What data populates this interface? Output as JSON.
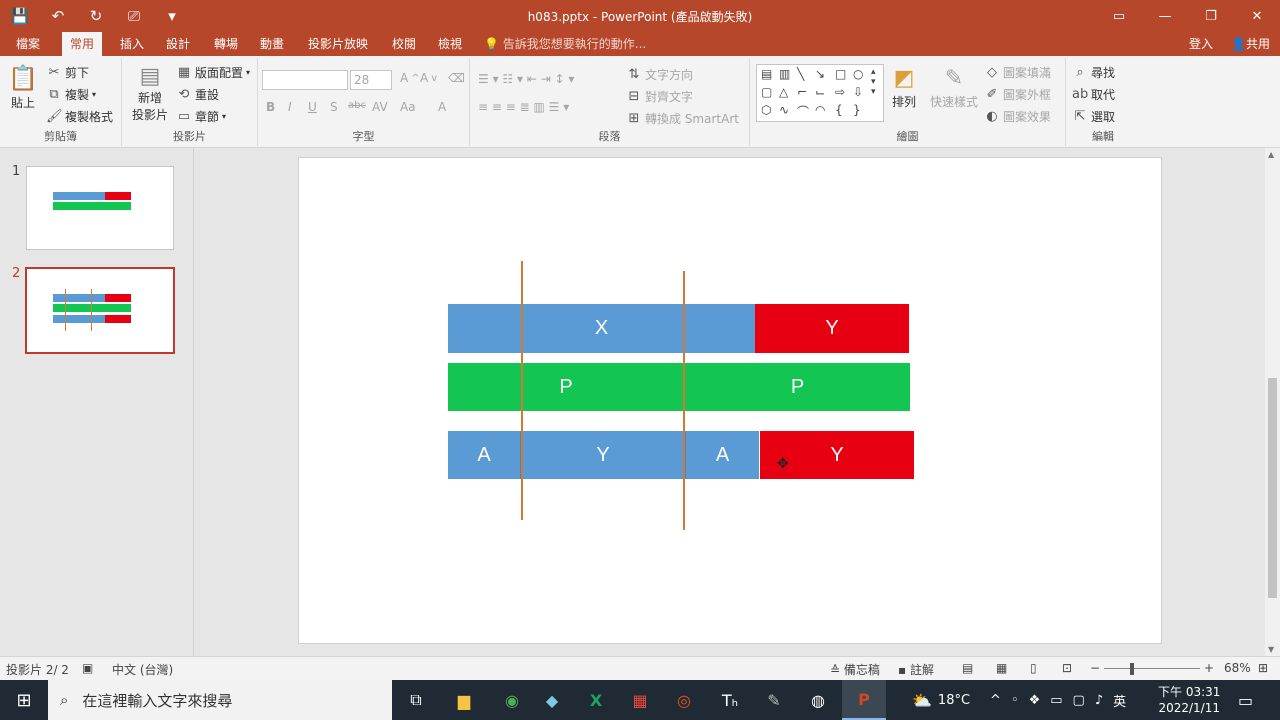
{
  "window": {
    "title": "h083.pptx - PowerPoint (產品啟動失敗)",
    "qat": [
      "💾",
      "↶",
      "↻",
      "⎚",
      "▾"
    ],
    "controls": [
      "▭",
      "—",
      "❐",
      "✕"
    ]
  },
  "tabs": [
    "檔案",
    "常用",
    "插入",
    "設計",
    "轉場",
    "動畫",
    "投影片放映",
    "校閱",
    "檢視"
  ],
  "tell_me": "告訴我您想要執行的動作...",
  "signin": "登入",
  "share": "共用",
  "ribbon": {
    "clipboard": {
      "paste": "貼上",
      "cut": "剪下",
      "copy": "複製",
      "format_painter": "複製格式",
      "label": "剪貼簿"
    },
    "slides": {
      "new_slide_line1": "新增",
      "new_slide_line2": "投影片",
      "layout": "版面配置",
      "reset": "重設",
      "section": "章節",
      "label": "投影片"
    },
    "font": {
      "size": "28",
      "label": "字型",
      "buttons": [
        "B",
        "I",
        "U",
        "S",
        "abc",
        "AV",
        "Aa",
        "A"
      ]
    },
    "paragraph": {
      "text_direction": "文字方向",
      "align_text": "對齊文字",
      "smartart": "轉換成 SmartArt",
      "label": "段落"
    },
    "drawing": {
      "arrange": "排列",
      "quick_styles": "快速樣式",
      "fill": "圖案填滿",
      "outline": "圖案外框",
      "effects": "圖案效果",
      "label": "繪圖"
    },
    "editing": {
      "find": "尋找",
      "replace": "取代",
      "select": "選取",
      "label": "編輯"
    }
  },
  "thumbnails": [
    {
      "num": "1"
    },
    {
      "num": "2"
    }
  ],
  "slide": {
    "row1": [
      {
        "label": "X"
      },
      {
        "label": "Y"
      }
    ],
    "row2": [
      {
        "label": "P"
      },
      {
        "label": "P"
      }
    ],
    "row3": [
      {
        "label": "A"
      },
      {
        "label": "Y"
      },
      {
        "label": "A"
      },
      {
        "label": "Y"
      }
    ]
  },
  "status": {
    "slide_count": "投影片 2/ 2",
    "language": "中文 (台灣)",
    "notes": "備忘稿",
    "comments": "註解",
    "zoom": "68%"
  },
  "taskbar": {
    "search_placeholder": "在這裡輸入文字來搜尋",
    "weather": "18°C",
    "ime": "英",
    "time": "下午 03:31",
    "date": "2022/1/11"
  }
}
